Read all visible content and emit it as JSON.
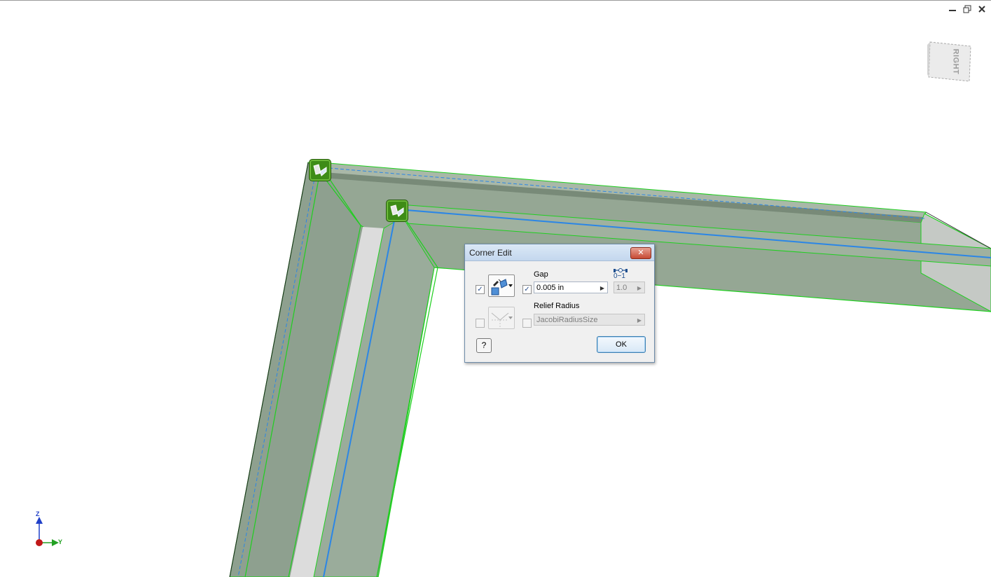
{
  "viewcube": {
    "face_label": "RIGHT"
  },
  "window_controls": [
    "minimize-icon",
    "restore-icon",
    "close-icon"
  ],
  "triad": {
    "z": "Z",
    "y": "Y"
  },
  "dialog": {
    "title": "Corner Edit",
    "close_glyph": "✕",
    "gap_label": "Gap",
    "gap_value": "0.005 in",
    "gap_checked": true,
    "relief_radius_label": "Relief Radius",
    "relief_radius_value": "JacobiRadiusSize",
    "relief_radius_checked": false,
    "relief_enabled": false,
    "ratio_icon_label": "0−1",
    "ratio_value": "1.0",
    "ok_label": "OK",
    "help_glyph": "?"
  },
  "colors": {
    "frame_face": "#93a592",
    "frame_inner": "#8aa08c",
    "frame_light": "#d6d6d6",
    "edge_highlight": "#24d424",
    "path_line": "#2b86e6",
    "glyph_green": "#3e8c17"
  }
}
